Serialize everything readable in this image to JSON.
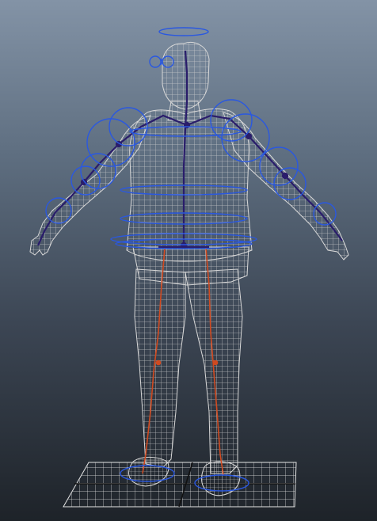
{
  "viewport": {
    "background_top": "#8393a6",
    "background_bottom": "#1e2329",
    "wireframe_color": "#d0d0d0",
    "joint_control_color": "#2a58e0",
    "joint_color": "#2a1d6b",
    "leg_joint_color": "#d04a20",
    "grid_color": "#e6e6e6"
  },
  "scene": {
    "objects": [
      {
        "name": "character-mesh",
        "display": "wireframe"
      },
      {
        "name": "skeleton-rig",
        "display": "joints"
      },
      {
        "name": "nurbs-controls",
        "display": "curves"
      },
      {
        "name": "ground-grid",
        "display": "grid"
      }
    ]
  }
}
